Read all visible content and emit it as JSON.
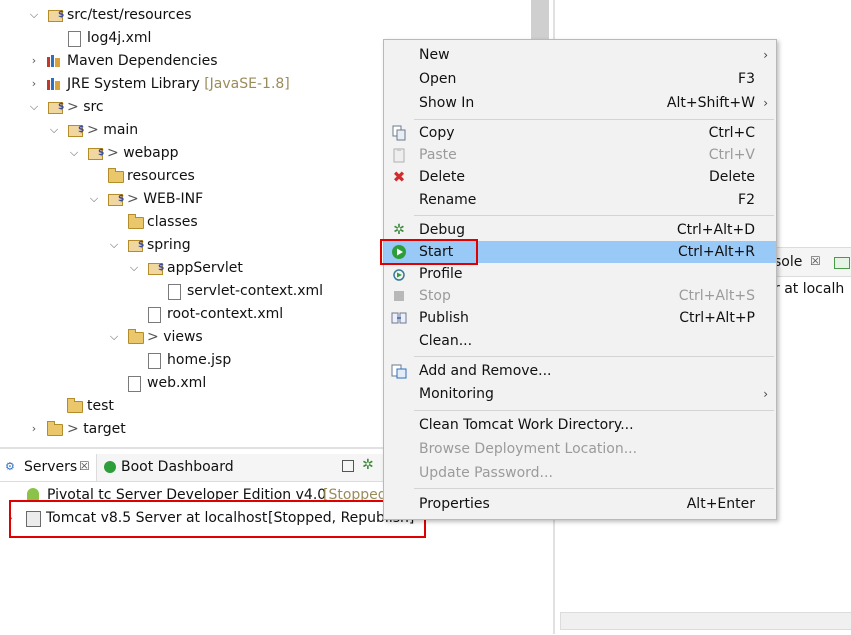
{
  "tree": [
    {
      "label": "src/test/resources",
      "twisty": "v"
    },
    {
      "label": "log4j.xml",
      "twisty": ""
    },
    {
      "label": "Maven Dependencies",
      "twisty": ">"
    },
    {
      "label": "JRE System Library",
      "suffix": "[JavaSE-1.8]",
      "twisty": ">"
    },
    {
      "label": "src",
      "prefix": ">",
      "twisty": "v"
    },
    {
      "label": "main",
      "prefix": ">",
      "twisty": "v"
    },
    {
      "label": "webapp",
      "prefix": ">",
      "twisty": "v"
    },
    {
      "label": "resources",
      "twisty": ""
    },
    {
      "label": "WEB-INF",
      "prefix": ">",
      "twisty": "v"
    },
    {
      "label": "classes",
      "twisty": ""
    },
    {
      "label": "spring",
      "twisty": "v"
    },
    {
      "label": "appServlet",
      "twisty": "v"
    },
    {
      "label": "servlet-context.xml",
      "twisty": ""
    },
    {
      "label": "root-context.xml",
      "twisty": ""
    },
    {
      "label": "views",
      "prefix": ">",
      "twisty": "v"
    },
    {
      "label": "home.jsp",
      "twisty": ""
    },
    {
      "label": "web.xml",
      "twisty": ""
    },
    {
      "label": "test",
      "twisty": ""
    },
    {
      "label": "target",
      "prefix": ">",
      "twisty": ">"
    }
  ],
  "servers_panel": {
    "tabs": [
      {
        "label": "Servers",
        "close": "☒"
      },
      {
        "label": "Boot Dashboard"
      }
    ],
    "servers": [
      {
        "name": "Pivotal tc Server Developer Edition v4.0",
        "status": "[Stopped]"
      },
      {
        "name": "Tomcat v8.5 Server at localhost",
        "status": "[Stopped, Republish]"
      }
    ]
  },
  "right_panel": {
    "tab_label": "sole",
    "content_text": "r at localh"
  },
  "context_menu": {
    "items": [
      {
        "label": "New",
        "shortcut": "",
        "submenu": true,
        "disabled": false,
        "icon": ""
      },
      {
        "label": "Open",
        "shortcut": "F3",
        "submenu": false,
        "disabled": false,
        "icon": ""
      },
      {
        "label": "Show In",
        "shortcut": "Alt+Shift+W",
        "submenu": true,
        "disabled": false,
        "icon": ""
      },
      {
        "label": "Copy",
        "shortcut": "Ctrl+C",
        "submenu": false,
        "disabled": false,
        "icon": "copy-icon"
      },
      {
        "label": "Paste",
        "shortcut": "Ctrl+V",
        "submenu": false,
        "disabled": true,
        "icon": "paste-icon"
      },
      {
        "label": "Delete",
        "shortcut": "Delete",
        "submenu": false,
        "disabled": false,
        "icon": "delete-icon"
      },
      {
        "label": "Rename",
        "shortcut": "F2",
        "submenu": false,
        "disabled": false,
        "icon": ""
      },
      {
        "label": "Debug",
        "shortcut": "Ctrl+Alt+D",
        "submenu": false,
        "disabled": false,
        "icon": "debug-icon"
      },
      {
        "label": "Start",
        "shortcut": "Ctrl+Alt+R",
        "submenu": false,
        "disabled": false,
        "icon": "start-icon"
      },
      {
        "label": "Profile",
        "shortcut": "",
        "submenu": false,
        "disabled": false,
        "icon": "profile-icon"
      },
      {
        "label": "Stop",
        "shortcut": "Ctrl+Alt+S",
        "submenu": false,
        "disabled": true,
        "icon": "stop-icon"
      },
      {
        "label": "Publish",
        "shortcut": "Ctrl+Alt+P",
        "submenu": false,
        "disabled": false,
        "icon": "publish-icon"
      },
      {
        "label": "Clean...",
        "shortcut": "",
        "submenu": false,
        "disabled": false,
        "icon": ""
      },
      {
        "label": "Add and Remove...",
        "shortcut": "",
        "submenu": false,
        "disabled": false,
        "icon": "add-remove-icon"
      },
      {
        "label": "Monitoring",
        "shortcut": "",
        "submenu": true,
        "disabled": false,
        "icon": ""
      },
      {
        "label": "Clean Tomcat Work Directory...",
        "shortcut": "",
        "submenu": false,
        "disabled": false,
        "icon": ""
      },
      {
        "label": "Browse Deployment Location...",
        "shortcut": "",
        "submenu": false,
        "disabled": true,
        "icon": ""
      },
      {
        "label": "Update Password...",
        "shortcut": "",
        "submenu": false,
        "disabled": true,
        "icon": ""
      },
      {
        "label": "Properties",
        "shortcut": "Alt+Enter",
        "submenu": false,
        "disabled": false,
        "icon": ""
      }
    ],
    "highlighted": "Start"
  },
  "colors": {
    "highlight": "#99c9f6",
    "callout_red": "#e00000",
    "delete_red": "#d22b2b",
    "start_green": "#2e9e3a"
  }
}
